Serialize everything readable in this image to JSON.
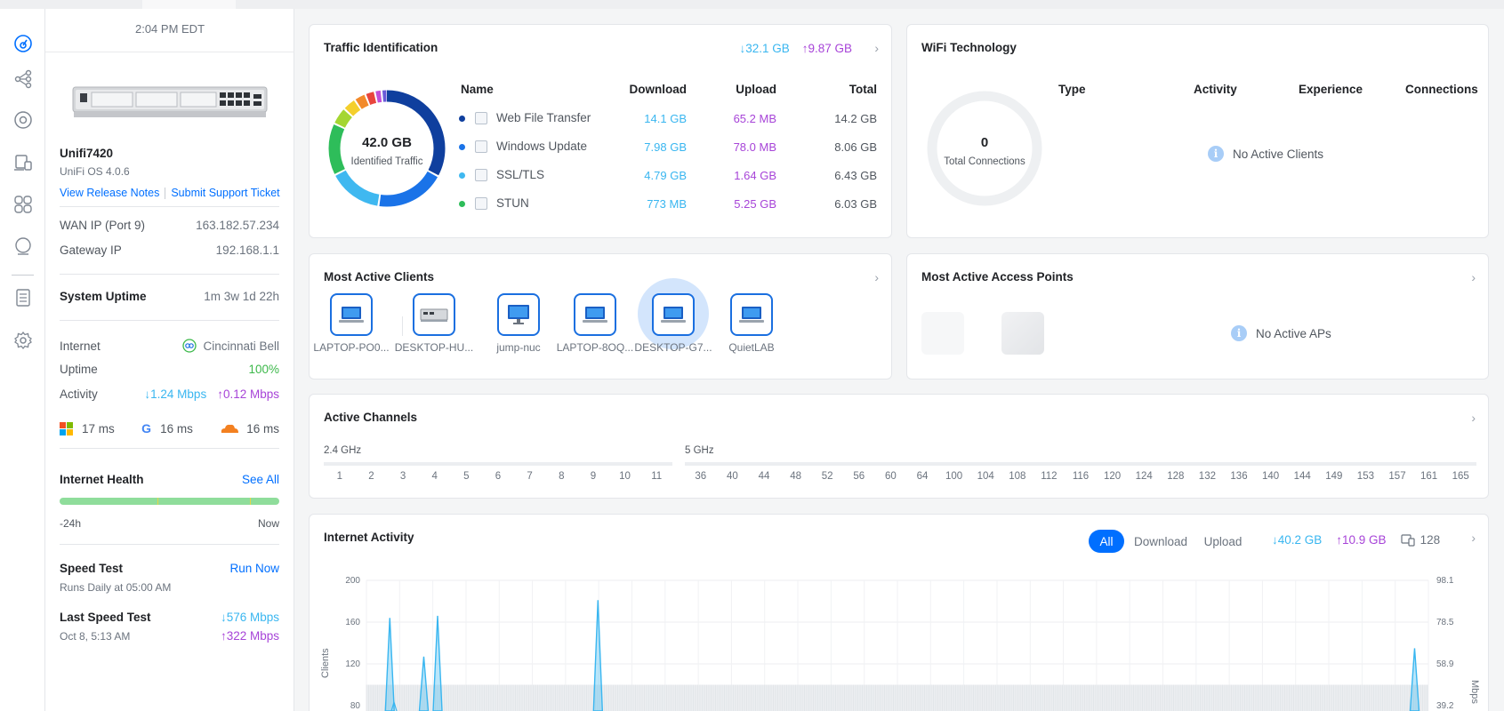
{
  "colors": {
    "accent": "#006fff",
    "download": "#39b6f0",
    "upload": "#a744d8",
    "good": "#3cb84a"
  },
  "rail": {
    "icons": [
      "dashboard-icon",
      "topology-icon",
      "devices-icon",
      "clients-icon",
      "insights-icon",
      "protect-icon",
      "logs-icon",
      "settings-icon"
    ]
  },
  "side": {
    "time": "2:04 PM EDT",
    "device_name": "Unifi7420",
    "os_version": "UniFi OS 4.0.6",
    "view_release_notes": "View Release Notes",
    "submit_ticket": "Submit Support Ticket",
    "wan_label": "WAN IP (Port 9)",
    "wan_value": "163.182.57.234",
    "gateway_label": "Gateway IP",
    "gateway_value": "192.168.1.1",
    "uptime_label": "System Uptime",
    "uptime_value": "1m 3w 1d 22h",
    "internet_label": "Internet",
    "isp": "Cincinnati Bell",
    "inet_uptime_label": "Uptime",
    "inet_uptime_value": "100%",
    "activity_label": "Activity",
    "activity_down": "↓1.24 Mbps",
    "activity_up": "↑0.12 Mbps",
    "latency_ms": "17 ms",
    "latency_google": "16 ms",
    "latency_cf": "16 ms",
    "health_title": "Internet Health",
    "see_all": "See All",
    "health_start": "-24h",
    "health_end": "Now",
    "speedtest_title": "Speed Test",
    "run_now": "Run Now",
    "speedtest_schedule": "Runs Daily at 05:00 AM",
    "last_test_title": "Last Speed Test",
    "last_test_date": "Oct 8, 5:13 AM",
    "last_down": "↓576 Mbps",
    "last_up": "↑322 Mbps"
  },
  "traffic": {
    "title": "Traffic Identification",
    "down_total": "↓32.1 GB",
    "up_total": "↑9.87 GB",
    "center_value": "42.0 GB",
    "center_label": "Identified Traffic",
    "headers": {
      "name": "Name",
      "download": "Download",
      "upload": "Upload",
      "total": "Total"
    },
    "rows": [
      {
        "name": "Web File Transfer",
        "download": "14.1 GB",
        "upload": "65.2 MB",
        "total": "14.2 GB",
        "color": "#0f3f9e",
        "icon": "file-transfer-icon"
      },
      {
        "name": "Windows Update",
        "download": "7.98 GB",
        "upload": "78.0 MB",
        "total": "8.06 GB",
        "color": "#1a73e8",
        "icon": "windows-update-icon"
      },
      {
        "name": "SSL/TLS",
        "download": "4.79 GB",
        "upload": "1.64 GB",
        "total": "6.43 GB",
        "color": "#3fb8f0",
        "icon": "shield-lock-icon"
      },
      {
        "name": "STUN",
        "download": "773 MB",
        "upload": "5.25 GB",
        "total": "6.03 GB",
        "color": "#2ebd5a",
        "icon": "stun-icon"
      }
    ]
  },
  "wifi": {
    "title": "WiFi Technology",
    "count": "0",
    "count_label": "Total Connections",
    "headers": {
      "type": "Type",
      "activity": "Activity",
      "experience": "Experience",
      "connections": "Connections"
    },
    "empty": "No Active Clients"
  },
  "clients": {
    "title": "Most Active Clients",
    "items": [
      {
        "label": "LAPTOP-PO0...",
        "icon": "laptop-icon"
      },
      {
        "label": "DESKTOP-HU...",
        "icon": "desktop-tower-icon"
      },
      {
        "label": "jump-nuc",
        "icon": "monitor-icon"
      },
      {
        "label": "LAPTOP-8OQ...",
        "icon": "laptop-icon"
      },
      {
        "label": "DESKTOP-G7...",
        "icon": "laptop-icon"
      },
      {
        "label": "QuietLAB",
        "icon": "laptop-icon"
      }
    ]
  },
  "aps": {
    "title": "Most Active Access Points",
    "empty": "No Active APs"
  },
  "channels": {
    "title": "Active Channels",
    "band24": "2.4 GHz",
    "band5": "5 GHz",
    "ch24": [
      "1",
      "2",
      "3",
      "4",
      "5",
      "6",
      "7",
      "8",
      "9",
      "10",
      "11"
    ],
    "ch5": [
      "36",
      "40",
      "44",
      "48",
      "52",
      "56",
      "60",
      "64",
      "100",
      "104",
      "108",
      "112",
      "116",
      "120",
      "124",
      "128",
      "132",
      "136",
      "140",
      "144",
      "149",
      "153",
      "157",
      "161",
      "165"
    ]
  },
  "activity": {
    "title": "Internet Activity",
    "seg_all": "All",
    "seg_download": "Download",
    "seg_upload": "Upload",
    "down_total": "↓40.2 GB",
    "up_total": "↑10.9 GB",
    "clients_count": "128",
    "y_left_label": "Clients",
    "y_right_label": "Mbps"
  },
  "chart_data": {
    "type": "area",
    "y_left_ticks": [
      "200",
      "160",
      "120",
      "80"
    ],
    "y_right_ticks": [
      "98.1",
      "78.5",
      "58.9",
      "39.2"
    ],
    "ylim_left": [
      80,
      200
    ],
    "spikes_mbps": [
      {
        "x": 0.022,
        "value": 164
      },
      {
        "x": 0.054,
        "value": 127
      },
      {
        "x": 0.067,
        "value": 166
      },
      {
        "x": 0.218,
        "value": 181
      },
      {
        "x": 0.987,
        "value": 135
      }
    ],
    "baseline_clients": 100
  }
}
